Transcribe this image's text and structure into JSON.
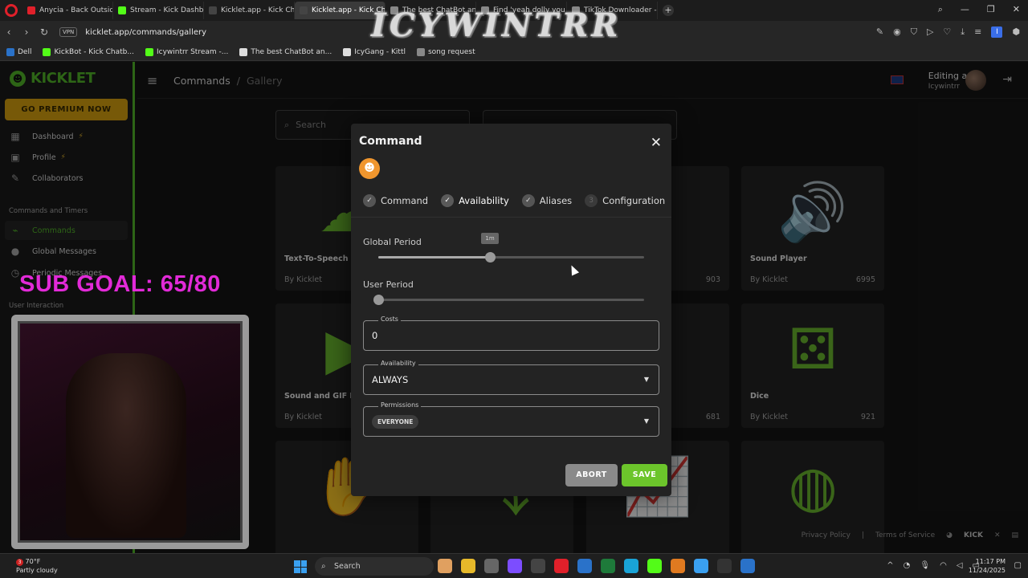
{
  "browser": {
    "tabs": [
      {
        "label": "Anycia - Back Outside",
        "color": "#e0202a",
        "active": false
      },
      {
        "label": "Stream - Kick Dashboard",
        "color": "#53fc18",
        "active": false
      },
      {
        "label": "Kicklet.app - Kick Chatbot",
        "color": "#444444",
        "active": false
      },
      {
        "label": "Kicklet.app - Kick Chatbot",
        "color": "#444444",
        "active": true
      },
      {
        "label": "The best ChatBot and W",
        "color": "#888888",
        "active": false
      },
      {
        "label": "Find 'yeah dolly you lost'",
        "color": "#888888",
        "active": false
      },
      {
        "label": "TikTok Downloader - Down",
        "color": "#888888",
        "active": false
      }
    ],
    "url": "kicklet.app/commands/gallery",
    "vpn_label": "VPN",
    "bookmarks": [
      {
        "label": "Dell",
        "color": "#2a72c9"
      },
      {
        "label": "KickBot - Kick Chatb...",
        "color": "#53fc18"
      },
      {
        "label": "Icywintrr Stream -...",
        "color": "#53fc18"
      },
      {
        "label": "The best ChatBot an...",
        "color": "#dddddd"
      },
      {
        "label": "IcyGang - Kittl",
        "color": "#dddddd"
      },
      {
        "label": "song request",
        "color": "#888888"
      }
    ],
    "overlay_title": "ICYWINTRR"
  },
  "sidebar": {
    "brand": "KICKLET",
    "premium_label": "GO PREMIUM NOW",
    "items": [
      {
        "label": "Dashboard",
        "bolt": true,
        "icon": "dashboard-icon",
        "glyph": "▦"
      },
      {
        "label": "Profile",
        "bolt": true,
        "icon": "profile-icon",
        "glyph": "▣"
      },
      {
        "label": "Collaborators",
        "bolt": false,
        "icon": "collaborators-icon",
        "glyph": "✎"
      }
    ],
    "section_commands": "Commands and Timers",
    "commands_items": [
      {
        "label": "Commands",
        "icon": "commands-icon",
        "glyph": "⌁"
      },
      {
        "label": "Global Messages",
        "icon": "global-messages-icon",
        "glyph": "●"
      },
      {
        "label": "Periodic Messages",
        "icon": "periodic-messages-icon",
        "glyph": "◷"
      }
    ],
    "section_user": "User Interaction"
  },
  "topbar": {
    "crumb_root": "Commands",
    "crumb_sep": "/",
    "crumb_current": "Gallery",
    "editing_label": "Editing as",
    "username": "Icywintrr"
  },
  "gallery": {
    "search_placeholder": "Search",
    "cards": [
      {
        "title": "Text-To-Speech",
        "by": "By Kicklet",
        "downloads": "",
        "glyph": "☁"
      },
      {
        "title": "Sound Player",
        "by": "By Kicklet",
        "downloads": "6995",
        "glyph": "🔊"
      },
      {
        "title": "Sound and GIF Pl",
        "by": "By Kicklet",
        "downloads": "",
        "glyph": "▶"
      },
      {
        "title": "Dice",
        "by": "By Kicklet",
        "downloads": "921",
        "glyph": "⚄"
      }
    ],
    "hidden_downloads": [
      "903",
      "681"
    ]
  },
  "footer": {
    "privacy": "Privacy Policy",
    "sep": "|",
    "terms": "Terms of Service",
    "kick": "KICK"
  },
  "modal": {
    "title": "Command",
    "emoji": "☻",
    "steps": [
      {
        "label": "Command",
        "state": "done",
        "mark": "✓"
      },
      {
        "label": "Availability",
        "state": "active",
        "mark": "✓"
      },
      {
        "label": "Aliases",
        "state": "done",
        "mark": "✓"
      },
      {
        "label": "Configuration",
        "state": "pending",
        "mark": "3"
      }
    ],
    "global_period_label": "Global Period",
    "global_period_tooltip": "1m",
    "global_period_fraction": 0.42,
    "user_period_label": "User Period",
    "user_period_fraction": 0.0,
    "costs_label": "Costs",
    "costs_value": "0",
    "availability_label": "Availability",
    "availability_value": "ALWAYS",
    "permissions_label": "Permissions",
    "permissions_chip": "EVERYONE",
    "abort_label": "ABORT",
    "save_label": "SAVE"
  },
  "stream": {
    "sub_goal": "SUB GOAL: 65/80"
  },
  "taskbar": {
    "weather_temp": "70°F",
    "weather_desc": "Partly cloudy",
    "weather_badge": "3",
    "search_label": "Search",
    "time": "11:17 PM",
    "date": "11/24/2025",
    "apps": [
      "#e0a060",
      "#e6b92a",
      "#666666",
      "#7c4dff",
      "#444444",
      "#e0202a",
      "#2a72c9",
      "#1e7a3a",
      "#19a3d6",
      "#53fc18",
      "#e07a20",
      "#3aa0f0",
      "#333333",
      "#2a72c9"
    ]
  }
}
